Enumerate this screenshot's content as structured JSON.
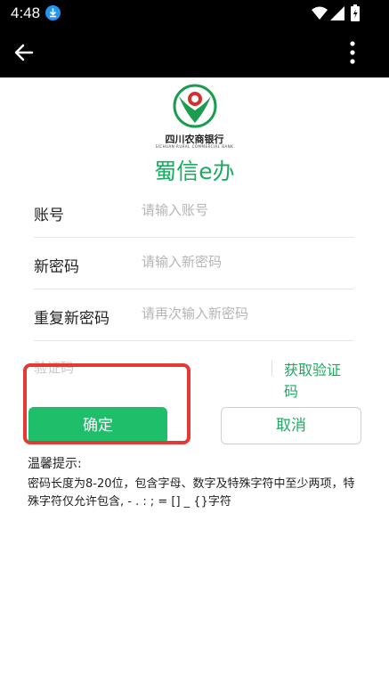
{
  "status_bar": {
    "time": "4:48"
  },
  "brand": {
    "name_cn": "四川农商银行",
    "name_en": "SICHUAN RURAL COMMERCIAL BANK"
  },
  "app_title": "蜀信e办",
  "form": {
    "account": {
      "label": "账号",
      "placeholder": "请输入账号"
    },
    "new_password": {
      "label": "新密码",
      "placeholder": "请输入新密码"
    },
    "repeat_password": {
      "label": "重复新密码",
      "placeholder": "请再次输入新密码"
    },
    "verification": {
      "label": "验证码",
      "get_code_label": "获取验证码"
    }
  },
  "buttons": {
    "confirm": "确定",
    "cancel": "取消"
  },
  "tips": {
    "title": "温馨提示:",
    "text": "密码长度为8-20位，包含字母、数字及特殊字符中至少两项，特殊字符仅允许包含, - . : ; = [] _ {}字符"
  },
  "colors": {
    "accent": "#1faa62",
    "confirm_bg": "#1fbe6b",
    "highlight": "#e53935"
  }
}
